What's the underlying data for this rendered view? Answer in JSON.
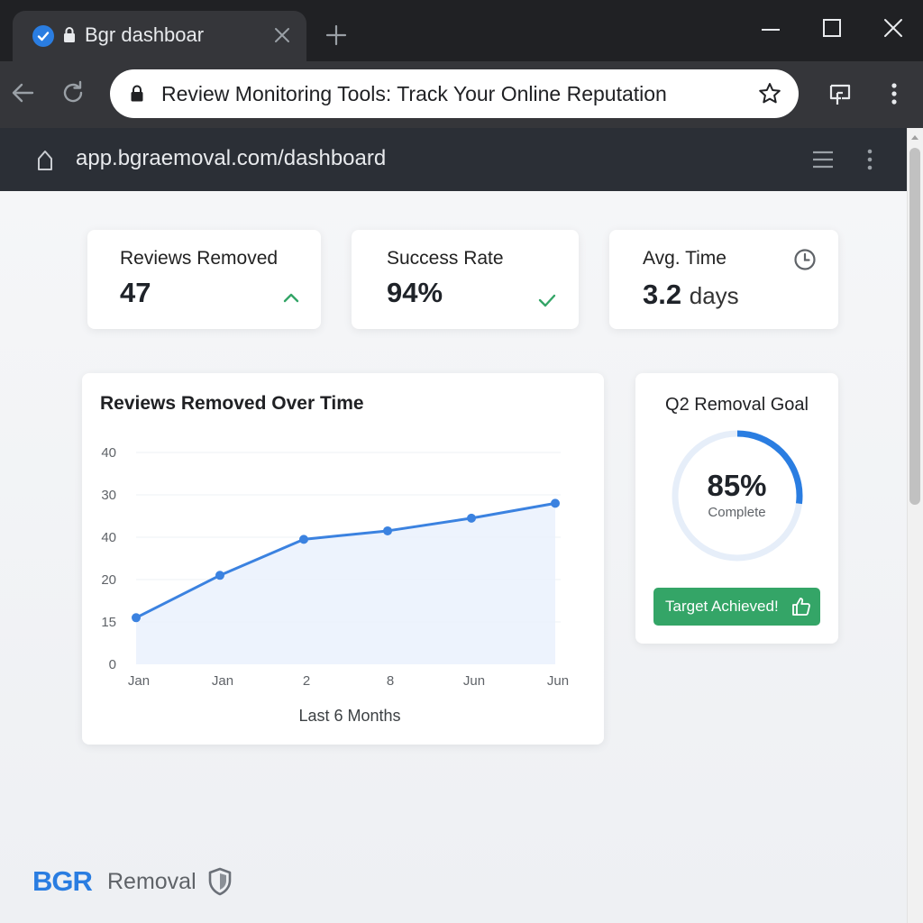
{
  "browser": {
    "tab_title": "Bgr dashboar",
    "address_text": "Review Monitoring Tools: Track Your Online Reputation"
  },
  "app": {
    "url": "app.bgraemoval.com/dashboard"
  },
  "stats": [
    {
      "label": "Reviews Removed",
      "value": "47",
      "icon": "chevron-up-icon",
      "icon_color": "#34a567"
    },
    {
      "label": "Success Rate",
      "value": "94%",
      "icon": "check-icon",
      "icon_color": "#34a567"
    },
    {
      "label": "Avg. Time",
      "value": "3.2",
      "unit": "days",
      "icon": "clock-icon",
      "icon_color": "#5f6368"
    }
  ],
  "chart": {
    "title": "Reviews Removed Over Time",
    "xlabel": "Last 6 Months"
  },
  "chart_data": {
    "type": "area",
    "title": "Reviews Removed Over Time",
    "xlabel": "Last 6 Months",
    "ylabel": "",
    "categories": [
      "Jan",
      "Jan",
      "2",
      "8",
      "Jun",
      "Jun"
    ],
    "y_tick_labels": [
      "0",
      "15",
      "20",
      "40",
      "30",
      "40"
    ],
    "values": [
      11,
      21,
      29.5,
      31.5,
      34.5,
      38
    ],
    "ylim": [
      0,
      50
    ],
    "grid": true,
    "line_color": "#3b82e0",
    "fill_color": "#e8f0fc"
  },
  "goal": {
    "title": "Q2 Removal Goal",
    "percent_label": "85%",
    "percent": 0.85,
    "sub_label": "Complete",
    "button_label": "Target Achieved!",
    "ring_color": "#2a7de1",
    "ring_track_color": "#e6eef9"
  },
  "brand": {
    "bgr": "BGR",
    "rest": "Removal"
  },
  "colors": {
    "accent": "#2a7de1",
    "success": "#34a567"
  }
}
